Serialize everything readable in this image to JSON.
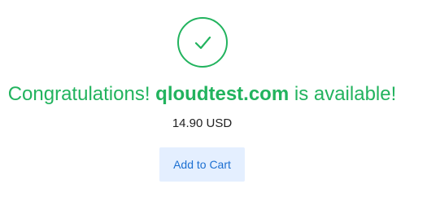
{
  "result": {
    "icon": "checkmark-circle-icon",
    "headline_prefix": "Congratulations! ",
    "domain": "qloudtest.com",
    "headline_suffix": " is available!",
    "price": "14.90 USD",
    "add_to_cart_label": "Add to Cart"
  },
  "colors": {
    "success": "#22b35e",
    "button_bg": "#e4efff",
    "button_text": "#1c6fd1",
    "price_text": "#222222"
  }
}
